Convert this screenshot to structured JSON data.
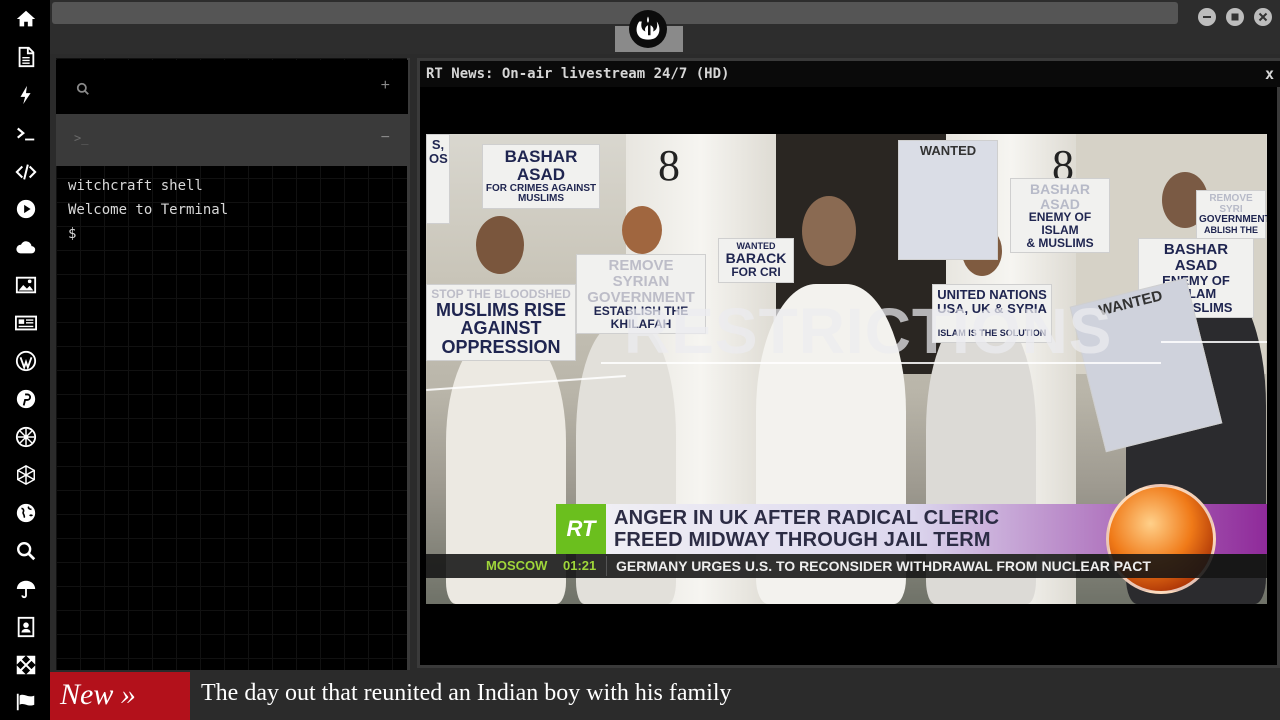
{
  "sidebar": {
    "items": [
      "home-icon",
      "document-icon",
      "lightning-icon",
      "terminal-icon",
      "code-icon",
      "play-icon",
      "cloud-icon",
      "image-icon",
      "news-icon",
      "wordpress-icon",
      "pinterest-icon",
      "settings-wheel-icon",
      "network-globe-icon",
      "world-icon",
      "search-icon",
      "umbrella-icon",
      "contacts-icon",
      "expand-icon",
      "flag-icon"
    ]
  },
  "topbar": {
    "logo": "rebel-alliance-icon",
    "window_buttons": [
      "minimize-icon",
      "maximize-icon",
      "close-icon"
    ]
  },
  "terminal": {
    "search_icon": "search-icon",
    "add_label": "+",
    "tab_prompt": ">_",
    "tab_close_label": "−",
    "lines": [
      "witchcraft shell",
      "Welcome to Terminal",
      "$"
    ]
  },
  "news_panel": {
    "title": "RT News: On-air livestream 24/7 (HD)",
    "close_label": "x",
    "video": {
      "overlay_word": "RESTRICTIONS",
      "logo_text": "RT",
      "headline_line1": "ANGER IN UK AFTER RADICAL CLERIC",
      "headline_line2": "FREED MIDWAY THROUGH JAIL TERM",
      "ticker_city": "MOSCOW",
      "ticker_time": "01:21",
      "ticker_text": "GERMANY URGES U.S. TO RECONSIDER WITHDRAWAL FROM NUCLEAR PACT",
      "signs": {
        "s1a": "BASHAR ASAD",
        "s1b": "FOR CRIMES AGAINST MUSLIMS",
        "s2a": "REMOVE SYRIAN",
        "s2b": "GOVERNMENT",
        "s2c": "ESTABLISH THE KHILAFAH",
        "s3a": "STOP THE BLOODSHED",
        "s3b": "MUSLIMS RISE",
        "s3c": "AGAINST",
        "s3d": "OPPRESSION",
        "s4a": "WANTED",
        "s4b": "BARACK",
        "s4c": "FOR CRI",
        "s5a": "WANTED",
        "s6a": "BASHAR ASAD",
        "s6b": "ENEMY OF ISLAM",
        "s6c": "& MUSLIMS",
        "s7a": "UNITED NATIONS",
        "s7b": "USA, UK & SYRIA",
        "s7c": "ISLAM IS THE SOLUTION",
        "s8a": "BASHAR ASAD",
        "s8b": "ENEMY OF ISLAM",
        "s8c": "& MUSLIMS",
        "s9a": "REMOVE SYRI",
        "s9b": "GOVERNMENT",
        "s9c": "ABLISH THE",
        "s10a": "WANTED",
        "s11a": "S,",
        "s11b": "OS",
        "s12a": "BASHAR ASAD",
        "s13a": "8",
        "s13b": "8"
      }
    }
  },
  "bottom_bar": {
    "badge": "New »",
    "headline": "The day out that reunited an Indian boy with his family"
  },
  "colors": {
    "badge_red": "#b3111b",
    "rt_green": "#6bbf1e",
    "ticker_green": "#9fd63a"
  }
}
